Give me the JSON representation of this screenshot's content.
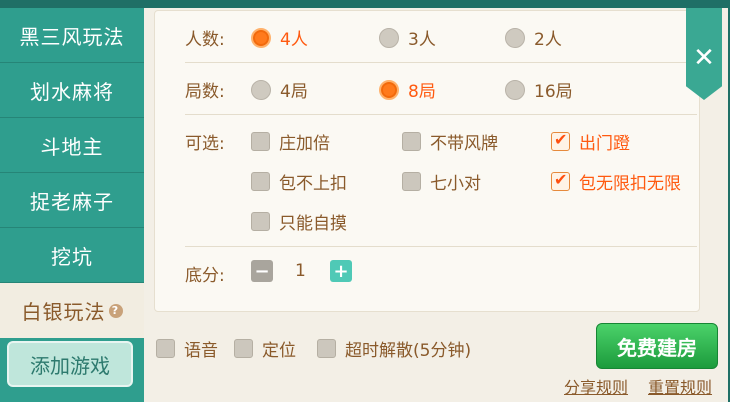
{
  "sidebar": {
    "items": [
      {
        "label": "黑三风玩法"
      },
      {
        "label": "划水麻将"
      },
      {
        "label": "斗地主"
      },
      {
        "label": "捉老麻子"
      },
      {
        "label": "挖坑"
      },
      {
        "label": "白银玩法",
        "help": "?"
      }
    ],
    "add_game": "添加游戏"
  },
  "players": {
    "label": "人数:",
    "options": [
      "4人",
      "3人",
      "2人"
    ],
    "selected": "4人"
  },
  "rounds": {
    "label": "局数:",
    "options": [
      "4局",
      "8局",
      "16局"
    ],
    "selected": "8局"
  },
  "optional": {
    "label": "可选:",
    "options": [
      {
        "label": "庄加倍",
        "checked": false
      },
      {
        "label": "不带风牌",
        "checked": false
      },
      {
        "label": "出门蹬",
        "checked": true
      },
      {
        "label": "包不上扣",
        "checked": false
      },
      {
        "label": "七小对",
        "checked": false
      },
      {
        "label": "包无限扣无限",
        "checked": true
      },
      {
        "label": "只能自摸",
        "checked": false
      }
    ]
  },
  "base_score": {
    "label": "底分:",
    "value": "1"
  },
  "bottom": {
    "options": [
      {
        "label": "语音",
        "checked": false
      },
      {
        "label": "定位",
        "checked": false
      },
      {
        "label": "超时解散(5分钟)",
        "checked": false
      }
    ],
    "create_button": "免费建房",
    "share_rules": "分享规则",
    "reset_rules": "重置规则"
  },
  "close": "✕"
}
